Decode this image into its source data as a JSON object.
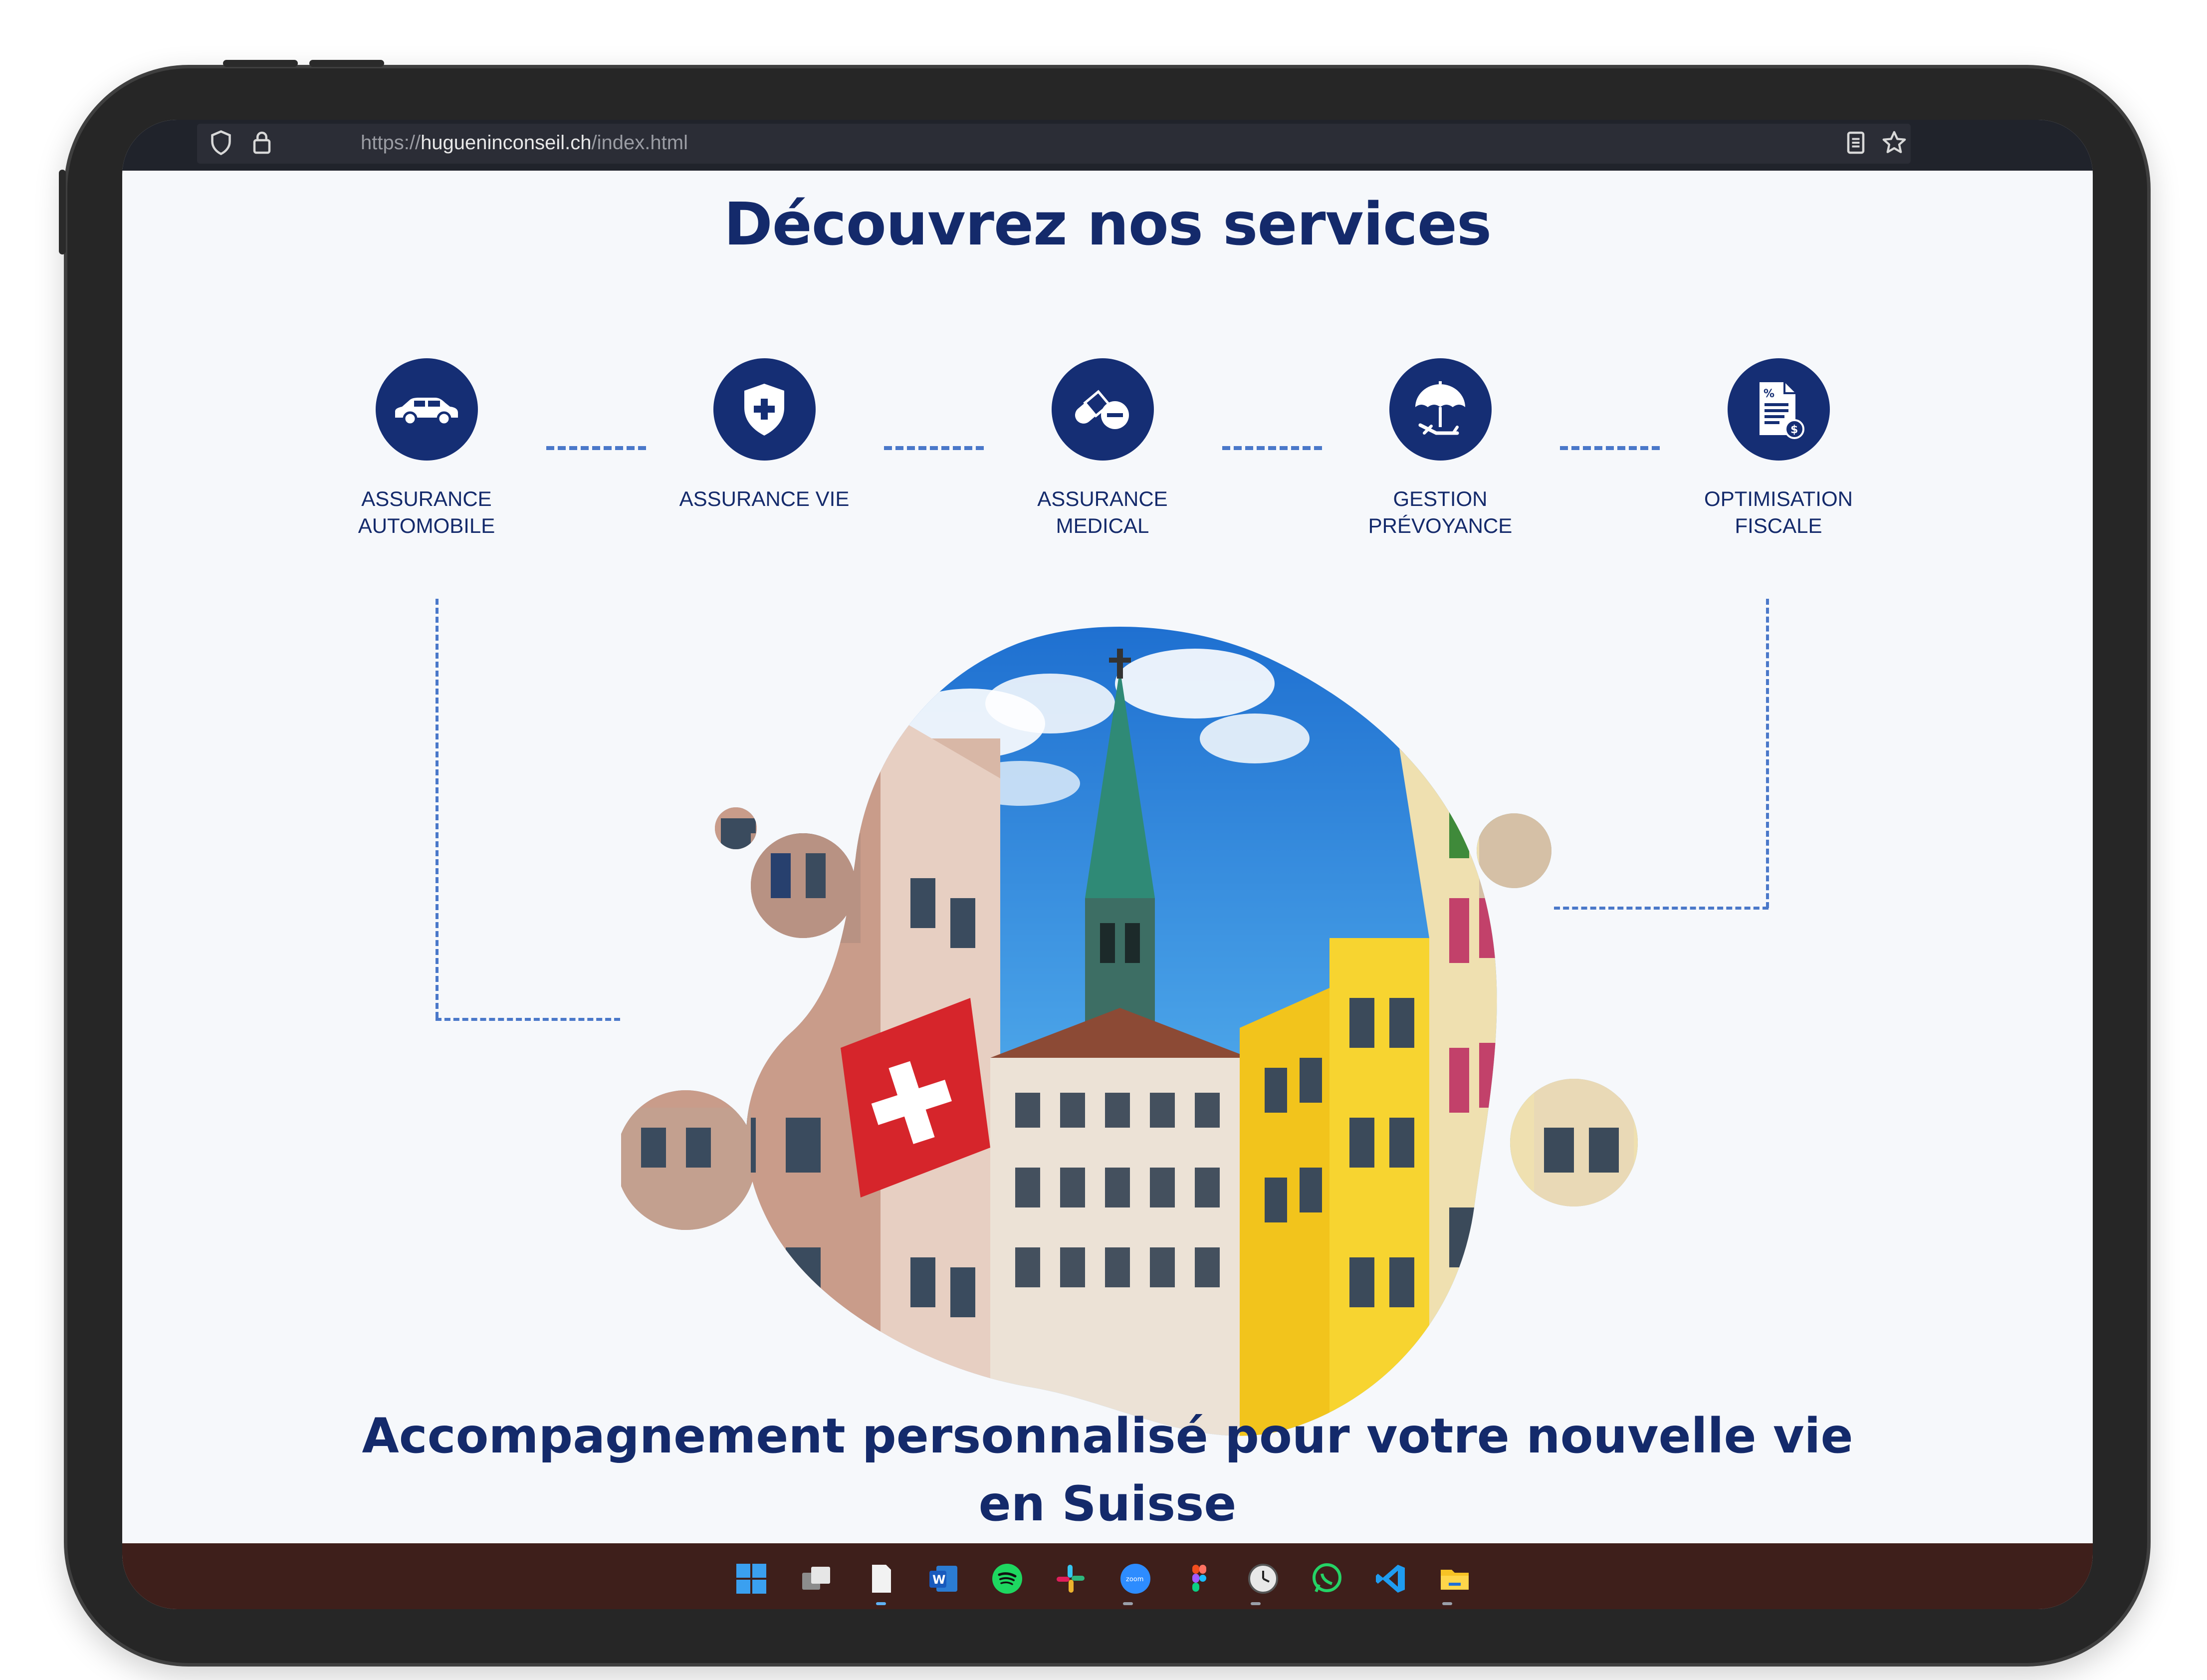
{
  "browser": {
    "url_prefix": "https://",
    "url_domain": "hugueninconseil.ch",
    "url_path": "/index.html",
    "icons": [
      "shield-icon",
      "lock-icon",
      "reader-view-icon",
      "bookmark-star-icon"
    ]
  },
  "page": {
    "heading": "Découvrez nos services",
    "subheading_line1": "Accompagnement personnalisé pour votre nouvelle vie",
    "subheading_line2": "en Suisse"
  },
  "services": [
    {
      "line1": "ASSURANCE",
      "line2": "AUTOMOBILE",
      "icon": "car-icon"
    },
    {
      "line1": "ASSURANCE VIE",
      "line2": "",
      "icon": "shield-cross-icon"
    },
    {
      "line1": "ASSURANCE",
      "line2": "MEDICAL",
      "icon": "pills-icon"
    },
    {
      "line1": "GESTION",
      "line2": "PRÉVOYANCE",
      "icon": "umbrella-chair-icon"
    },
    {
      "line1": "OPTIMISATION",
      "line2": "FISCALE",
      "icon": "tax-document-icon"
    }
  ],
  "taskbar": {
    "apps": [
      "windows-start-icon",
      "task-view-icon",
      "notepad-icon",
      "word-icon",
      "spotify-icon",
      "slack-icon",
      "zoom-icon",
      "figma-icon",
      "clock-icon",
      "whatsapp-icon",
      "vscode-icon",
      "file-explorer-icon"
    ],
    "zoom_label": "zoom"
  },
  "colors": {
    "brand_navy": "#142a6b",
    "icon_circle": "#152e74",
    "dash_blue": "#4a78c9",
    "page_bg": "#f6f8fb",
    "taskbar_bg": "#3e1f1b"
  }
}
